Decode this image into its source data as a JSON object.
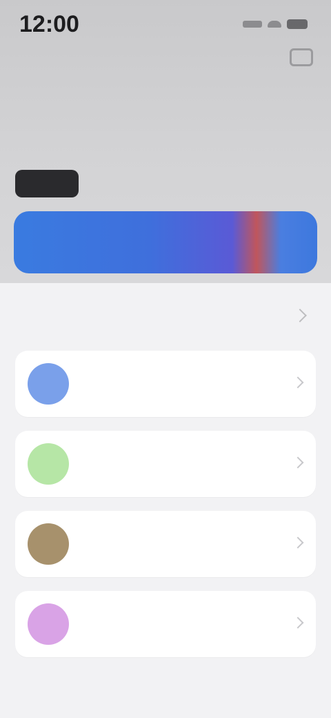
{
  "header": {
    "time": "12:00",
    "title": "",
    "subtitle": "",
    "tagline": "",
    "chip_label": "",
    "chip_note": "",
    "banner_text": ""
  },
  "section": {
    "title": ""
  },
  "cards": [
    {
      "label": "",
      "sub": "",
      "icon_color": "#7aa0ea",
      "icon_name": "blue-circle-icon"
    },
    {
      "label": "",
      "sub": "",
      "icon_color": "#b6e6a6",
      "icon_name": "green-circle-icon"
    },
    {
      "label": "",
      "sub": "",
      "icon_color": "#a7916c",
      "icon_name": "brown-circle-icon"
    },
    {
      "label": "",
      "sub": "",
      "icon_color": "#d9a3e6",
      "icon_name": "purple-circle-icon"
    }
  ],
  "colors": {
    "banner_start": "#3a7be0",
    "banner_end": "#3d78de",
    "background_top": "#c9c9cb",
    "background_bottom": "#f2f2f4"
  }
}
